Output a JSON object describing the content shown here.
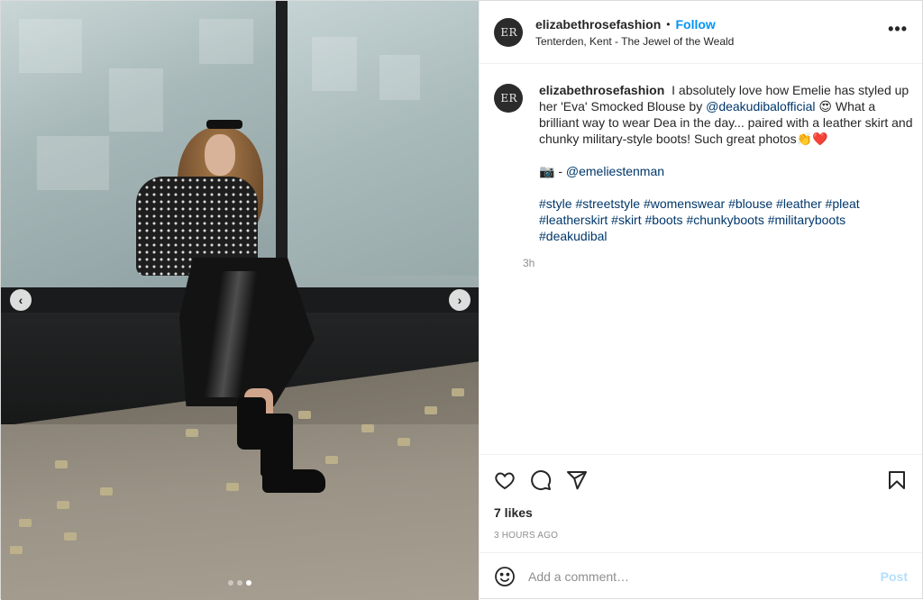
{
  "header": {
    "avatar_text": "E R",
    "username": "elizabethrosefashion",
    "separator": "•",
    "follow_label": "Follow",
    "location": "Tenterden, Kent - The Jewel of the Weald",
    "more_label": "•••"
  },
  "caption": {
    "avatar_text": "E R",
    "username": "elizabethrosefashion",
    "text_1": "I absolutely love how Emelie has styled up her 'Eva' Smocked Blouse by",
    "mention_1": "@deakudibalofficial",
    "text_2": "😍 What a brilliant way to wear Dea in the day... paired with a leather skirt and chunky military-style boots! Such great photos👏❤️",
    "camera_emoji": "📷",
    "credit_sep": " - ",
    "mention_2": "@emeliestenman",
    "hashtags": [
      "#style",
      "#streetstyle",
      "#womenswear",
      "#blouse",
      "#leather",
      "#pleat",
      "#leatherskirt",
      "#skirt",
      "#boots",
      "#chunkyboots",
      "#militaryboots",
      "#deakudibal"
    ],
    "time": "3h"
  },
  "actions": {
    "likes": "7 likes",
    "date": "3 HOURS AGO"
  },
  "comment_box": {
    "placeholder": "Add a comment…",
    "post_label": "Post"
  },
  "carousel": {
    "prev_label": "‹",
    "next_label": "›",
    "slide_count": 3,
    "active_slide": 3
  },
  "colors": {
    "accent": "#0095f6",
    "post_disabled": "#b2dffc",
    "link": "#00376b"
  }
}
